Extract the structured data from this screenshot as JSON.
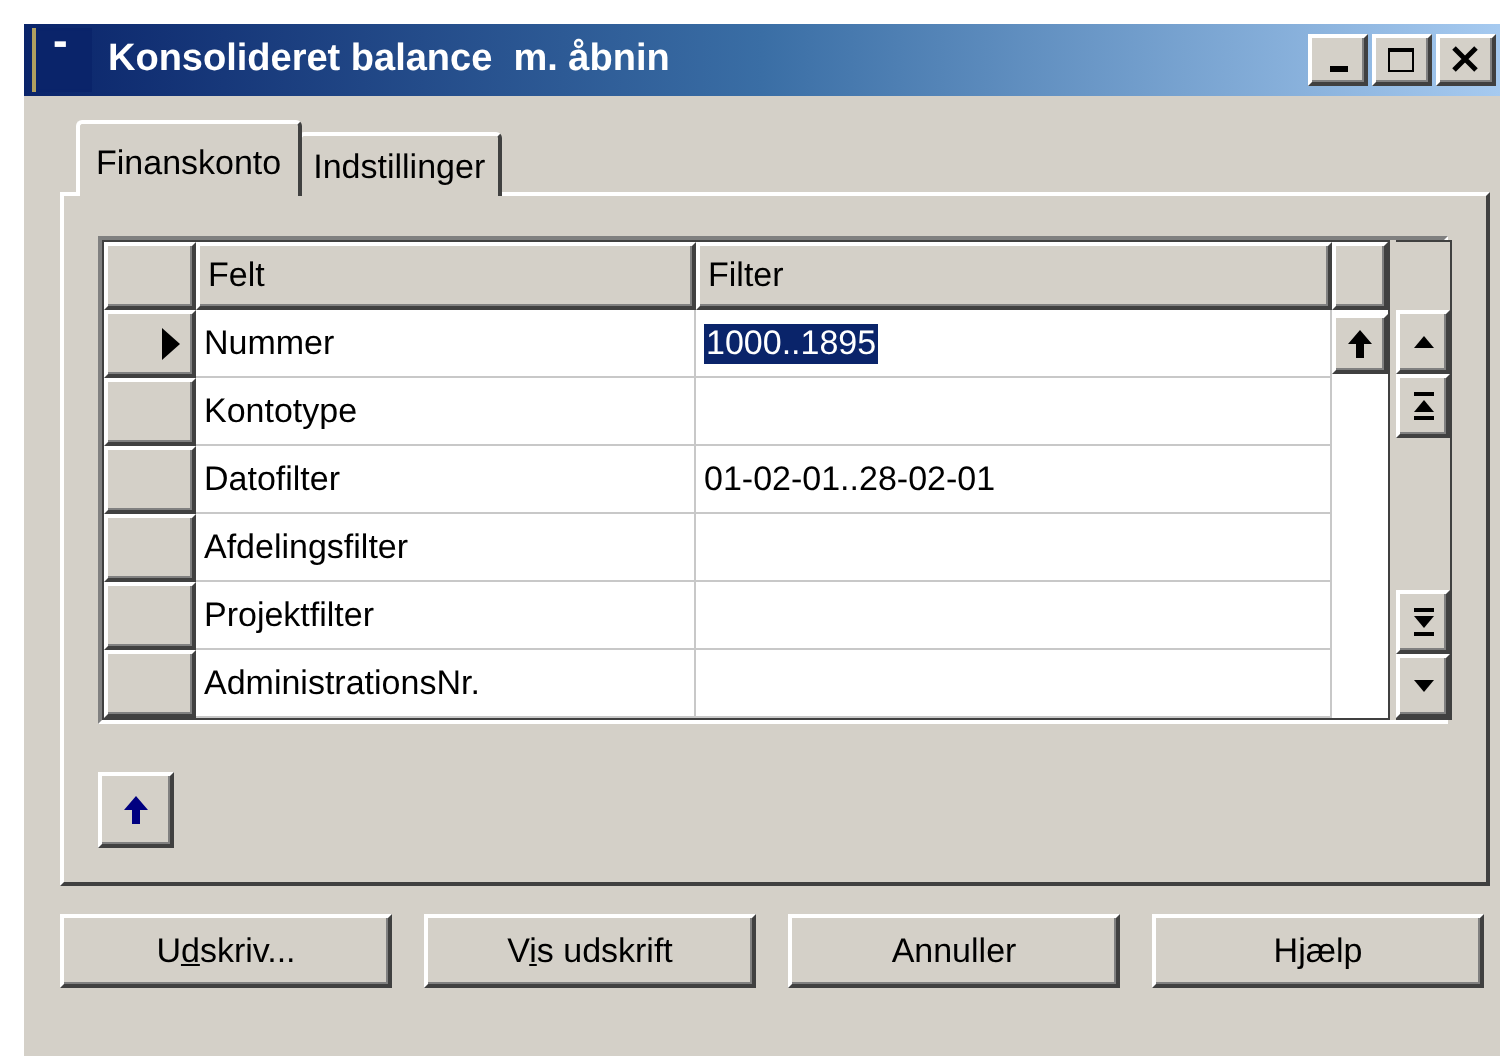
{
  "window": {
    "title": "Konsolideret balance  m. åbnin"
  },
  "tabs": [
    {
      "label": "Finanskonto",
      "selected": true
    },
    {
      "label": "Indstillinger",
      "selected": false
    }
  ],
  "table": {
    "columns": [
      "Felt",
      "Filter"
    ],
    "rows": [
      {
        "field": "Nummer",
        "filter": "1000..1895",
        "current": true,
        "filter_selected": true
      },
      {
        "field": "Kontotype",
        "current": false
      },
      {
        "field": "Datofilter",
        "filter": "01-02-01..28-02-01",
        "current": false,
        "filter_selected": false
      },
      {
        "field": "Afdelingsfilter",
        "current": false
      },
      {
        "field": "Projektfilter",
        "current": false
      },
      {
        "field": "AdministrationsNr.",
        "current": false
      }
    ]
  },
  "buttons": [
    {
      "before": "U",
      "accelerator": "d",
      "after": "skriv..."
    },
    {
      "before": "V",
      "accelerator": "i",
      "after": "s udskrift"
    },
    {
      "before": "Annuller"
    },
    {
      "before": "Hjælp"
    }
  ]
}
